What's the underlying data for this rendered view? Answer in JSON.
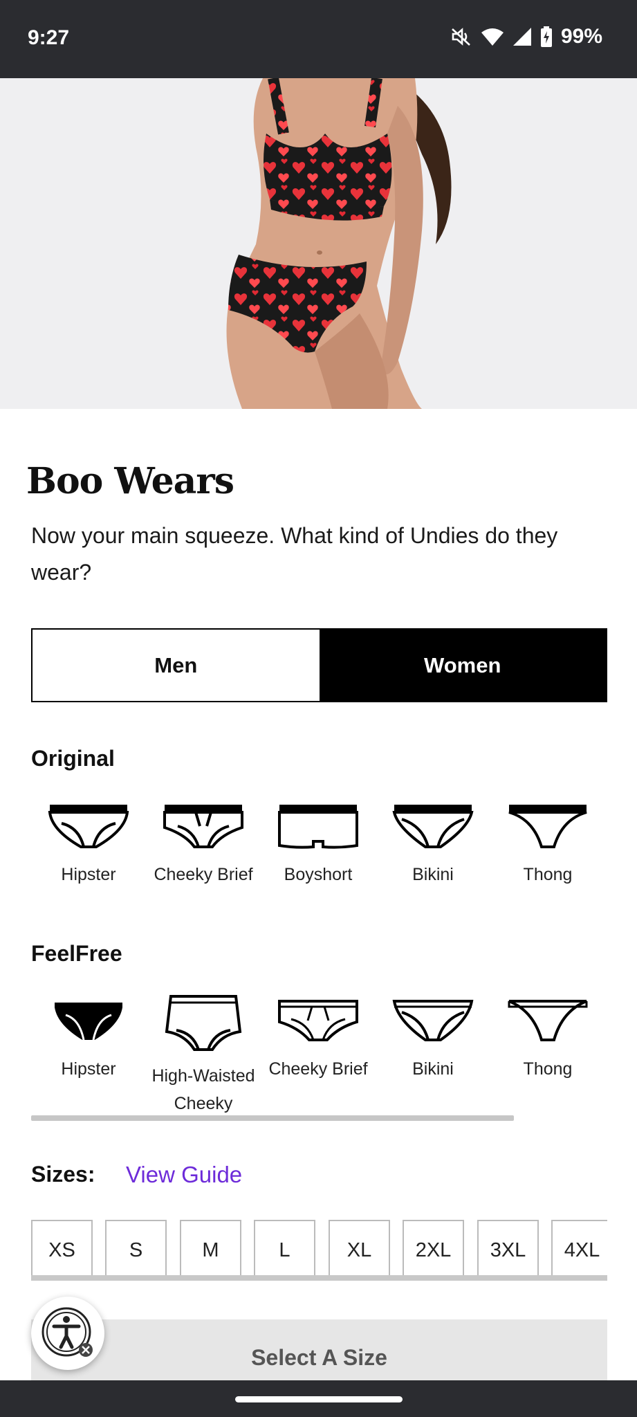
{
  "status_bar": {
    "time": "9:27",
    "battery": "99%",
    "icons": [
      "mute-icon",
      "wifi-icon",
      "signal-icon",
      "battery-charging-icon"
    ]
  },
  "hero": {
    "image": "model-in-heart-print-bralette-and-briefs"
  },
  "page": {
    "title": "Boo Wears",
    "subtitle": "Now your main squeeze. What kind of Undies do they wear?"
  },
  "gender_toggle": {
    "options": [
      "Men",
      "Women"
    ],
    "selected": "Women"
  },
  "original": {
    "label": "Original",
    "styles": [
      {
        "label": "Hipster",
        "icon": "hipster-icon"
      },
      {
        "label": "Cheeky Brief",
        "icon": "cheeky-brief-icon"
      },
      {
        "label": "Boyshort",
        "icon": "boyshort-icon"
      },
      {
        "label": "Bikini",
        "icon": "bikini-icon"
      },
      {
        "label": "Thong",
        "icon": "thong-icon"
      }
    ]
  },
  "feelfree": {
    "label": "FeelFree",
    "styles": [
      {
        "label": "Hipster",
        "icon": "hipster-icon"
      },
      {
        "label": "High-Waisted Cheeky",
        "icon": "high-waisted-cheeky-icon"
      },
      {
        "label": "Cheeky Brief",
        "icon": "cheeky-brief-icon"
      },
      {
        "label": "Bikini",
        "icon": "bikini-icon"
      },
      {
        "label": "Thong",
        "icon": "thong-icon"
      }
    ]
  },
  "sizes": {
    "label": "Sizes:",
    "guide_link": "View Guide",
    "options": [
      "XS",
      "S",
      "M",
      "L",
      "XL",
      "2XL",
      "3XL",
      "4XL"
    ]
  },
  "cta": {
    "label": "Select A Size"
  },
  "colors": {
    "accent_link": "#6d2bd9",
    "status_bar": "#2b2c30",
    "selected_toggle": "#000000",
    "cta_disabled": "#e6e6e6"
  }
}
